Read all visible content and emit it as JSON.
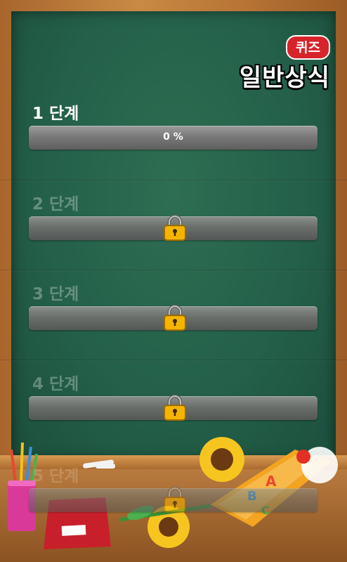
{
  "app": {
    "badge": "퀴즈",
    "title": "일반상식"
  },
  "stages": [
    {
      "label": "1 단계",
      "progress_text": "0 %",
      "progress": 0,
      "locked": false
    },
    {
      "label": "2 단계",
      "locked": true
    },
    {
      "label": "3 단계",
      "locked": true
    },
    {
      "label": "4 단계",
      "locked": true
    },
    {
      "label": "5 단계",
      "locked": true
    }
  ],
  "icons": {
    "lock": "lock-icon"
  },
  "colors": {
    "board": "#24604a",
    "lock": "#f4b400",
    "badge": "#d6242a"
  }
}
